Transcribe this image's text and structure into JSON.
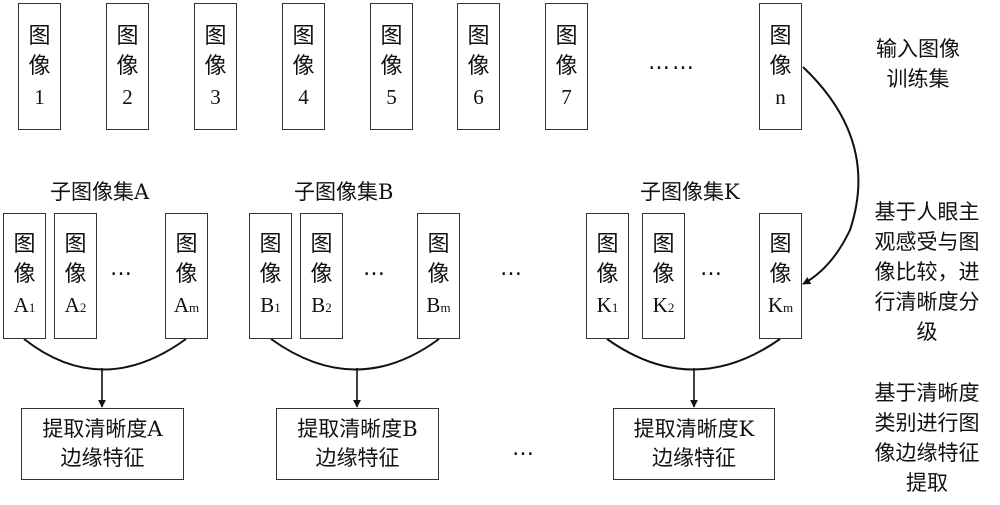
{
  "training_set": {
    "images": [
      {
        "char1": "图",
        "char2": "像",
        "index": "1"
      },
      {
        "char1": "图",
        "char2": "像",
        "index": "2"
      },
      {
        "char1": "图",
        "char2": "像",
        "index": "3"
      },
      {
        "char1": "图",
        "char2": "像",
        "index": "4"
      },
      {
        "char1": "图",
        "char2": "像",
        "index": "5"
      },
      {
        "char1": "图",
        "char2": "像",
        "index": "6"
      },
      {
        "char1": "图",
        "char2": "像",
        "index": "7"
      },
      {
        "char1": "图",
        "char2": "像",
        "index": "n"
      }
    ],
    "ellipsis": "……",
    "label_line1": "输入图像",
    "label_line2": "训练集"
  },
  "subsets": [
    {
      "title": "子图像集A",
      "images": [
        {
          "char1": "图",
          "char2": "像",
          "letter": "A",
          "sub": "1"
        },
        {
          "char1": "图",
          "char2": "像",
          "letter": "A",
          "sub": "2"
        },
        {
          "char1": "图",
          "char2": "像",
          "letter": "A",
          "sub": "m"
        }
      ],
      "ellipsis": "…",
      "extract_line1": "提取清晰度A",
      "extract_line2": "边缘特征"
    },
    {
      "title": "子图像集B",
      "images": [
        {
          "char1": "图",
          "char2": "像",
          "letter": "B",
          "sub": "1"
        },
        {
          "char1": "图",
          "char2": "像",
          "letter": "B",
          "sub": "2"
        },
        {
          "char1": "图",
          "char2": "像",
          "letter": "B",
          "sub": "m"
        }
      ],
      "ellipsis": "…",
      "extract_line1": "提取清晰度B",
      "extract_line2": "边缘特征"
    },
    {
      "title": "子图像集K",
      "images": [
        {
          "char1": "图",
          "char2": "像",
          "letter": "K",
          "sub": "1"
        },
        {
          "char1": "图",
          "char2": "像",
          "letter": "K",
          "sub": "2"
        },
        {
          "char1": "图",
          "char2": "像",
          "letter": "K",
          "sub": "m"
        }
      ],
      "ellipsis": "…",
      "extract_line1": "提取清晰度K",
      "extract_line2": "边缘特征"
    }
  ],
  "between_subsets_ellipsis": "…",
  "between_extract_ellipsis": "…",
  "step2_label": [
    "基于人眼主",
    "观感受与图",
    "像比较，进",
    "行清晰度分",
    "级"
  ],
  "step3_label": [
    "基于清晰度",
    "类别进行图",
    "像边缘特征",
    "提取"
  ]
}
